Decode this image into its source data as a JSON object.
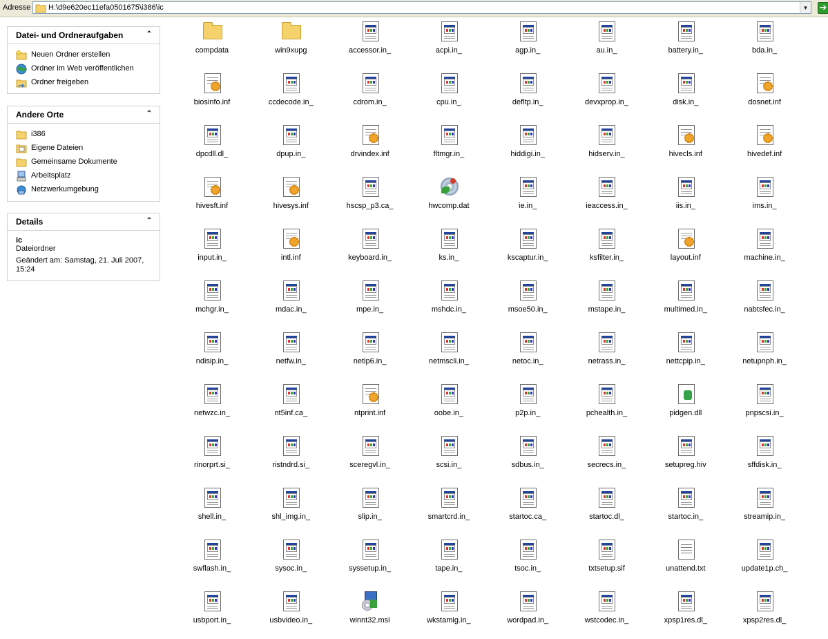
{
  "address": {
    "label": "Adresse",
    "path": "H:\\d9e620ec11efa0501675\\i386\\ic"
  },
  "taskpane": {
    "folder_tasks": {
      "title": "Datei- und Ordneraufgaben",
      "items": [
        {
          "label": "Neuen Ordner erstellen",
          "icon": "new-folder-icon"
        },
        {
          "label": "Ordner im Web veröffentlichen",
          "icon": "web-publish-icon"
        },
        {
          "label": "Ordner freigeben",
          "icon": "share-folder-icon"
        }
      ]
    },
    "other_places": {
      "title": "Andere Orte",
      "items": [
        {
          "label": "i386",
          "icon": "folder-icon"
        },
        {
          "label": "Eigene Dateien",
          "icon": "my-documents-icon"
        },
        {
          "label": "Gemeinsame Dokumente",
          "icon": "shared-documents-icon"
        },
        {
          "label": "Arbeitsplatz",
          "icon": "my-computer-icon"
        },
        {
          "label": "Netzwerkumgebung",
          "icon": "network-icon"
        }
      ]
    },
    "details": {
      "title": "Details",
      "name": "ic",
      "type": "Dateiordner",
      "modified": "Geändert am: Samstag, 21. Juli 2007, 15:24"
    }
  },
  "files": [
    {
      "name": "compdata",
      "icon": "folder"
    },
    {
      "name": "win9xupg",
      "icon": "folder"
    },
    {
      "name": "accessor.in_",
      "icon": "compressed"
    },
    {
      "name": "acpi.in_",
      "icon": "compressed"
    },
    {
      "name": "agp.in_",
      "icon": "compressed"
    },
    {
      "name": "au.in_",
      "icon": "compressed"
    },
    {
      "name": "battery.in_",
      "icon": "compressed"
    },
    {
      "name": "bda.in_",
      "icon": "compressed"
    },
    {
      "name": "biosinfo.inf",
      "icon": "inf"
    },
    {
      "name": "ccdecode.in_",
      "icon": "compressed"
    },
    {
      "name": "cdrom.in_",
      "icon": "compressed"
    },
    {
      "name": "cpu.in_",
      "icon": "compressed"
    },
    {
      "name": "defltp.in_",
      "icon": "compressed"
    },
    {
      "name": "devxprop.in_",
      "icon": "compressed"
    },
    {
      "name": "disk.in_",
      "icon": "compressed"
    },
    {
      "name": "dosnet.inf",
      "icon": "inf"
    },
    {
      "name": "dpcdll.dl_",
      "icon": "compressed"
    },
    {
      "name": "dpup.in_",
      "icon": "compressed"
    },
    {
      "name": "drvindex.inf",
      "icon": "inf"
    },
    {
      "name": "fltmgr.in_",
      "icon": "compressed"
    },
    {
      "name": "hiddigi.in_",
      "icon": "compressed"
    },
    {
      "name": "hidserv.in_",
      "icon": "compressed"
    },
    {
      "name": "hivecls.inf",
      "icon": "inf"
    },
    {
      "name": "hivedef.inf",
      "icon": "inf"
    },
    {
      "name": "hivesft.inf",
      "icon": "inf"
    },
    {
      "name": "hivesys.inf",
      "icon": "inf"
    },
    {
      "name": "hscsp_p3.ca_",
      "icon": "compressed"
    },
    {
      "name": "hwcomp.dat",
      "icon": "dat"
    },
    {
      "name": "ie.in_",
      "icon": "compressed"
    },
    {
      "name": "ieaccess.in_",
      "icon": "compressed"
    },
    {
      "name": "iis.in_",
      "icon": "compressed"
    },
    {
      "name": "ims.in_",
      "icon": "compressed"
    },
    {
      "name": "input.in_",
      "icon": "compressed"
    },
    {
      "name": "intl.inf",
      "icon": "inf"
    },
    {
      "name": "keyboard.in_",
      "icon": "compressed"
    },
    {
      "name": "ks.in_",
      "icon": "compressed"
    },
    {
      "name": "kscaptur.in_",
      "icon": "compressed"
    },
    {
      "name": "ksfilter.in_",
      "icon": "compressed"
    },
    {
      "name": "layout.inf",
      "icon": "inf"
    },
    {
      "name": "machine.in_",
      "icon": "compressed"
    },
    {
      "name": "mchgr.in_",
      "icon": "compressed"
    },
    {
      "name": "mdac.in_",
      "icon": "compressed"
    },
    {
      "name": "mpe.in_",
      "icon": "compressed"
    },
    {
      "name": "mshdc.in_",
      "icon": "compressed"
    },
    {
      "name": "msoe50.in_",
      "icon": "compressed"
    },
    {
      "name": "mstape.in_",
      "icon": "compressed"
    },
    {
      "name": "multimed.in_",
      "icon": "compressed"
    },
    {
      "name": "nabtsfec.in_",
      "icon": "compressed"
    },
    {
      "name": "ndisip.in_",
      "icon": "compressed"
    },
    {
      "name": "netfw.in_",
      "icon": "compressed"
    },
    {
      "name": "netip6.in_",
      "icon": "compressed"
    },
    {
      "name": "netmscli.in_",
      "icon": "compressed"
    },
    {
      "name": "netoc.in_",
      "icon": "compressed"
    },
    {
      "name": "netrass.in_",
      "icon": "compressed"
    },
    {
      "name": "nettcpip.in_",
      "icon": "compressed"
    },
    {
      "name": "netupnph.in_",
      "icon": "compressed"
    },
    {
      "name": "netwzc.in_",
      "icon": "compressed"
    },
    {
      "name": "nt5inf.ca_",
      "icon": "compressed"
    },
    {
      "name": "ntprint.inf",
      "icon": "inf"
    },
    {
      "name": "oobe.in_",
      "icon": "compressed"
    },
    {
      "name": "p2p.in_",
      "icon": "compressed"
    },
    {
      "name": "pchealth.in_",
      "icon": "compressed"
    },
    {
      "name": "pidgen.dll",
      "icon": "dll"
    },
    {
      "name": "pnpscsi.in_",
      "icon": "compressed"
    },
    {
      "name": "rinorprt.si_",
      "icon": "compressed"
    },
    {
      "name": "ristndrd.si_",
      "icon": "compressed"
    },
    {
      "name": "sceregvl.in_",
      "icon": "compressed"
    },
    {
      "name": "scsi.in_",
      "icon": "compressed"
    },
    {
      "name": "sdbus.in_",
      "icon": "compressed"
    },
    {
      "name": "secrecs.in_",
      "icon": "compressed"
    },
    {
      "name": "setupreg.hiv",
      "icon": "compressed"
    },
    {
      "name": "sffdisk.in_",
      "icon": "compressed"
    },
    {
      "name": "shell.in_",
      "icon": "compressed"
    },
    {
      "name": "shl_img.in_",
      "icon": "compressed"
    },
    {
      "name": "slip.in_",
      "icon": "compressed"
    },
    {
      "name": "smartcrd.in_",
      "icon": "compressed"
    },
    {
      "name": "startoc.ca_",
      "icon": "compressed"
    },
    {
      "name": "startoc.dl_",
      "icon": "compressed"
    },
    {
      "name": "startoc.in_",
      "icon": "compressed"
    },
    {
      "name": "streamip.in_",
      "icon": "compressed"
    },
    {
      "name": "swflash.in_",
      "icon": "compressed"
    },
    {
      "name": "sysoc.in_",
      "icon": "compressed"
    },
    {
      "name": "syssetup.in_",
      "icon": "compressed"
    },
    {
      "name": "tape.in_",
      "icon": "compressed"
    },
    {
      "name": "tsoc.in_",
      "icon": "compressed"
    },
    {
      "name": "txtsetup.sif",
      "icon": "compressed"
    },
    {
      "name": "unattend.txt",
      "icon": "txt"
    },
    {
      "name": "update1p.ch_",
      "icon": "compressed"
    },
    {
      "name": "usbport.in_",
      "icon": "compressed"
    },
    {
      "name": "usbvideo.in_",
      "icon": "compressed"
    },
    {
      "name": "winnt32.msi",
      "icon": "msi"
    },
    {
      "name": "wkstamig.in_",
      "icon": "compressed"
    },
    {
      "name": "wordpad.in_",
      "icon": "compressed"
    },
    {
      "name": "wstcodec.in_",
      "icon": "compressed"
    },
    {
      "name": "xpsp1res.dl_",
      "icon": "compressed"
    },
    {
      "name": "xpsp2res.dl_",
      "icon": "compressed"
    }
  ]
}
